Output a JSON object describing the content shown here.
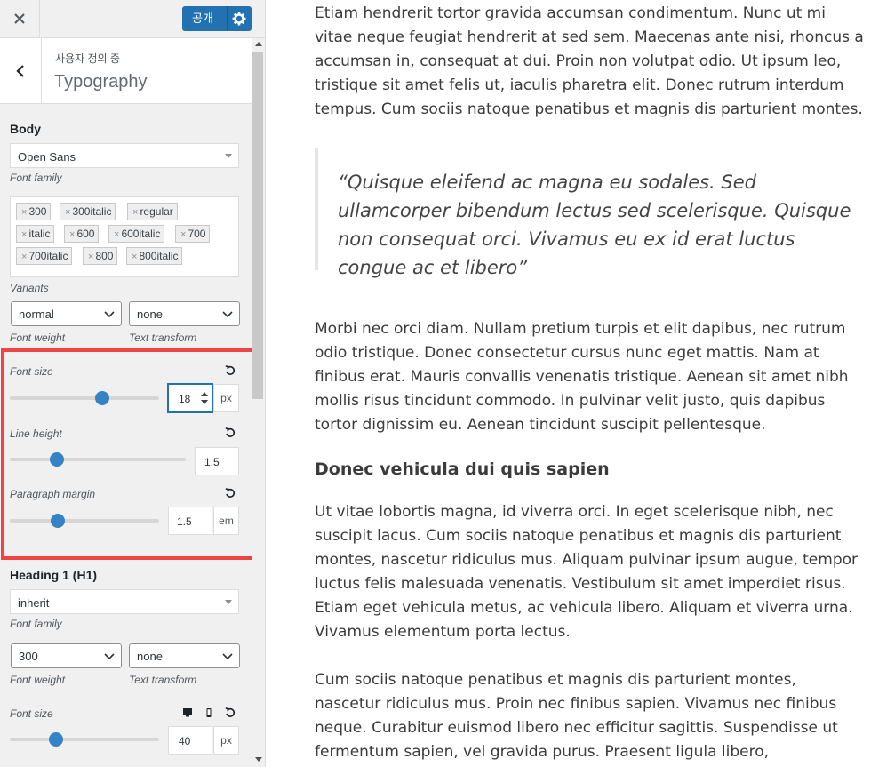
{
  "topbar": {
    "close_icon": "close-icon",
    "publish_label": "공개",
    "settings_icon": "gear-icon"
  },
  "section": {
    "customizing_label": "사용자 정의 중",
    "title": "Typography"
  },
  "body_group": {
    "title": "Body",
    "font_family": {
      "value": "Open Sans",
      "label": "Font family"
    },
    "variants": {
      "tags": [
        "300",
        "300italic",
        "regular",
        "italic",
        "600",
        "600italic",
        "700",
        "700italic",
        "800",
        "800italic"
      ],
      "label": "Variants"
    },
    "font_weight": {
      "value": "normal",
      "label": "Font weight"
    },
    "text_transform": {
      "value": "none",
      "label": "Text transform"
    },
    "font_size": {
      "label": "Font size",
      "value": "18",
      "unit": "px",
      "slider_fraction": 0.62
    },
    "line_height": {
      "label": "Line height",
      "value": "1.5",
      "slider_fraction": 0.27
    },
    "paragraph_margin": {
      "label": "Paragraph margin",
      "value": "1.5",
      "unit": "em",
      "slider_fraction": 0.32
    }
  },
  "heading1_group": {
    "title": "Heading 1 (H1)",
    "font_family": {
      "value": "inherit",
      "label": "Font family"
    },
    "font_weight": {
      "value": "300",
      "label": "Font weight"
    },
    "text_transform": {
      "value": "none",
      "label": "Text transform"
    },
    "font_size": {
      "label": "Font size",
      "value": "40",
      "unit": "px",
      "slider_fraction": 0.31
    }
  },
  "preview": {
    "para1": "Etiam hendrerit tortor gravida accumsan condimentum. Nunc ut mi vitae neque feugiat hendrerit at sed sem. Maecenas ante nisi, rhoncus a accumsan in, consequat at dui. Proin non volutpat odio. Ut ipsum leo, tristique sit amet felis ut, iaculis pharetra elit. Donec rutrum interdum tempus. Cum sociis natoque penatibus et magnis dis parturient montes.",
    "quote": "“Quisque eleifend ac magna eu sodales. Sed ullamcorper bibendum lectus sed scelerisque. Quisque non consequat orci. Vivamus eu ex id erat luctus congue ac et libero”",
    "para2": "Morbi nec orci diam. Nullam pretium turpis et elit dapibus, nec rutrum odio tristique. Donec consectetur cursus nunc eget mattis. Nam at finibus erat. Mauris convallis venenatis tristique. Aenean sit amet nibh mollis risus tincidunt commodo. In pulvinar velit justo, quis dapibus tortor dignissim eu. Aenean tincidunt suscipit pellentesque.",
    "heading": "Donec vehicula dui quis sapien",
    "para3": "Ut vitae lobortis magna, id viverra orci. In eget scelerisque nibh, nec suscipit lacus. Cum sociis natoque penatibus et magnis dis parturient montes, nascetur ridiculus mus. Aliquam pulvinar ipsum augue, tempor luctus felis malesuada venenatis. Vestibulum sit amet imperdiet risus. Etiam eget vehicula metus, ac vehicula libero. Aliquam et viverra urna. Vivamus elementum porta lectus.",
    "para4": "Cum sociis natoque penatibus et magnis dis parturient montes, nascetur ridiculus mus. Proin nec finibus sapien. Vivamus nec finibus neque. Curabitur euismod libero nec efficitur sagittis. Suspendisse ut fermentum sapien, vel gravida purus. Praesent ligula libero,"
  }
}
